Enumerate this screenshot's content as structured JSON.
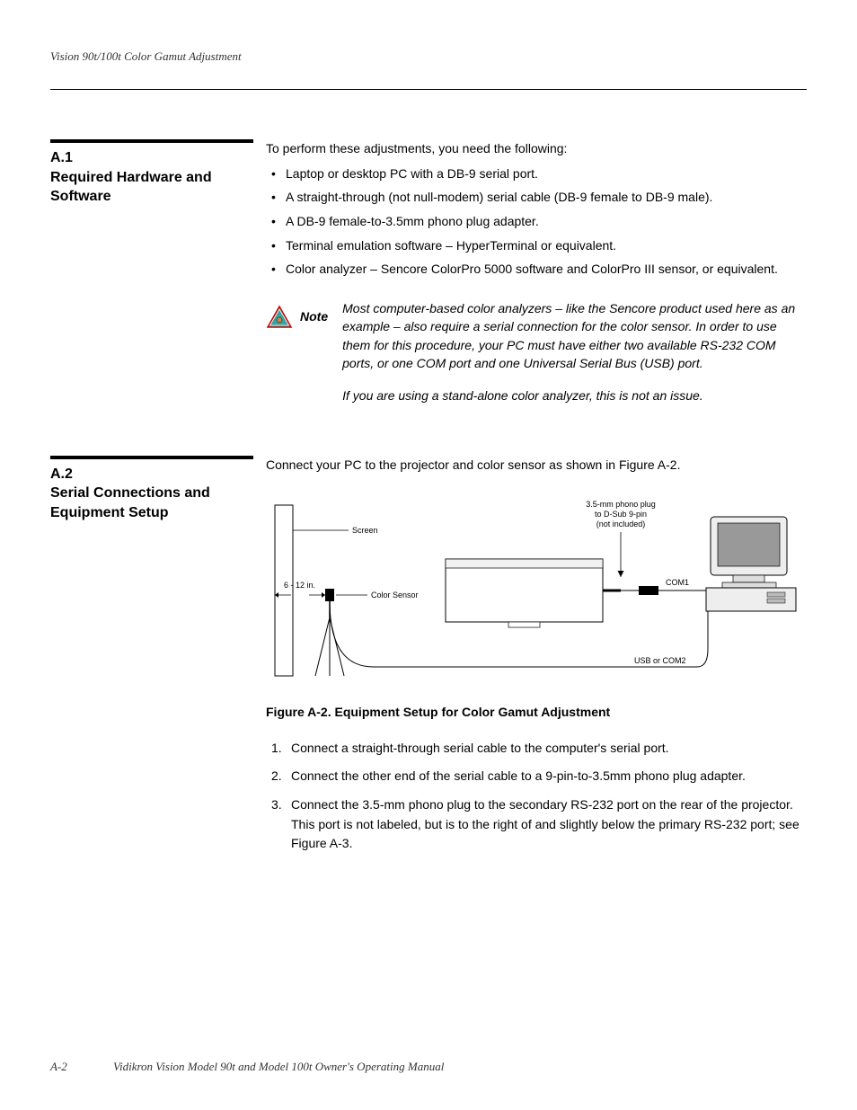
{
  "header": "Vision 90t/100t Color Gamut Adjustment",
  "s1": {
    "num": "A.1",
    "title": "Required Hardware and Software",
    "intro": "To perform these adjustments, you need the following:",
    "bullets": [
      "Laptop or desktop PC with a DB-9 serial port.",
      "A straight-through (not null-modem) serial cable (DB-9 female to DB-9 male).",
      "A DB-9 female-to-3.5mm phono plug adapter.",
      "Terminal emulation software – HyperTerminal or equivalent.",
      "Color analyzer – Sencore ColorPro 5000 software and ColorPro III sensor, or equivalent."
    ],
    "note_label": "Note",
    "note_p1": "Most computer-based color analyzers – like the Sencore product used here as an example – also require a serial connection for the color sensor. In order to use them for this procedure, your PC must have either two available RS-232 COM ports, or one COM port and one Universal Serial Bus (USB) port.",
    "note_p2": "If you are using a stand-alone color analyzer, this is not an issue."
  },
  "s2": {
    "num": "A.2",
    "title": "Serial Connections and Equipment Setup",
    "intro": "Connect your PC to the projector and color sensor as shown in Figure A-2.",
    "diagram": {
      "screen": "Screen",
      "range": "6 - 12 in.",
      "color_sensor": "Color Sensor",
      "phono1": "3.5-mm phono plug",
      "phono2": "to D-Sub 9-pin",
      "phono3": "(not included)",
      "com1": "COM1",
      "usb": "USB or COM2"
    },
    "figcap": "Figure A-2. Equipment Setup for Color Gamut Adjustment",
    "steps": [
      "Connect a straight-through serial cable to the computer's serial port.",
      "Connect the other end of the serial cable to a 9-pin-to-3.5mm phono plug adapter.",
      "Connect the 3.5-mm phono plug to the secondary RS-232 port on the rear of the projector. This port is not labeled, but is to the right of and slightly below the primary RS-232 port; see Figure A-3."
    ]
  },
  "footer": {
    "page": "A-2",
    "manual": "Vidikron Vision Model 90t and Model 100t Owner's Operating Manual"
  }
}
